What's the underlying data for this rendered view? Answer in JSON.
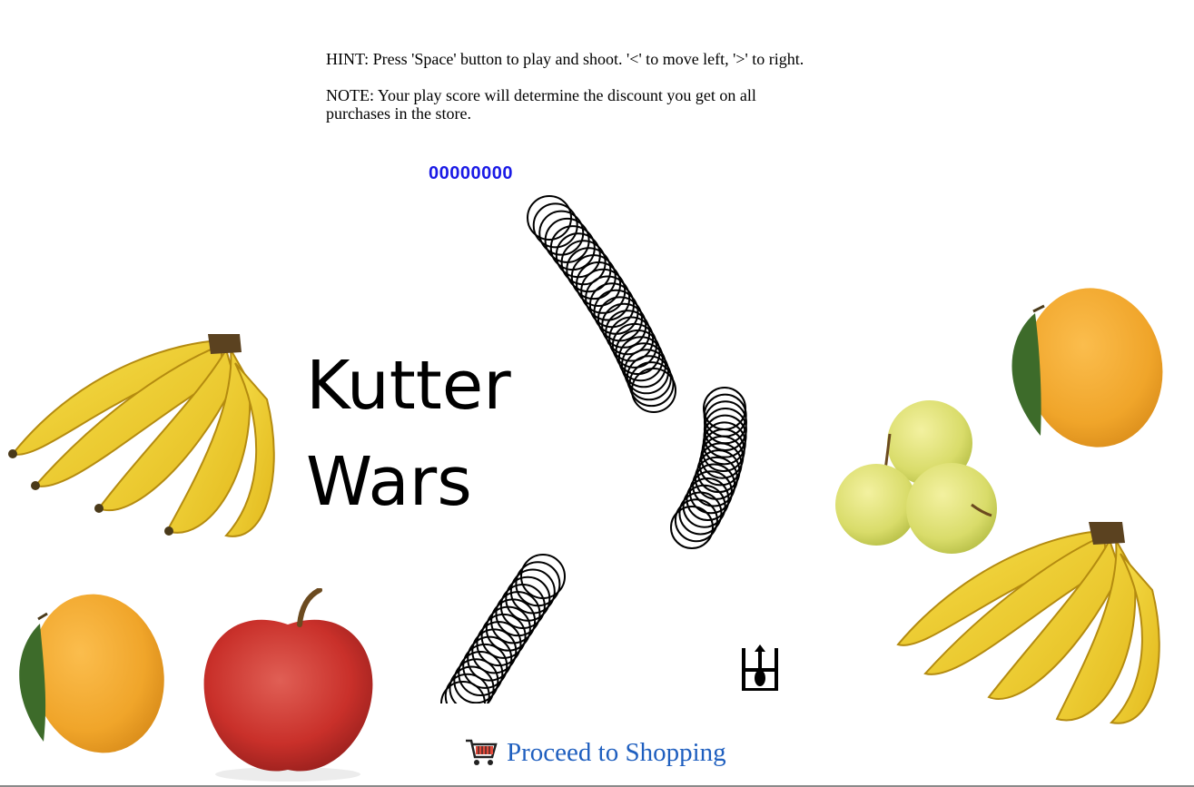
{
  "instructions": {
    "hint": "HINT: Press 'Space' button to play and shoot. '<' to move left, '>' to right.",
    "note": "NOTE: Your play score will determine the discount you get on all purchases in the store."
  },
  "game": {
    "score": "00000000",
    "title_line1": "Kutter",
    "title_line2": "Wars",
    "player_icon": "ship-icon",
    "enemies": "ring-chain-icons"
  },
  "decorations": {
    "left": [
      "banana-bunch",
      "mango",
      "red-apple"
    ],
    "right": [
      "mango",
      "green-apples",
      "banana-bunch"
    ]
  },
  "footer": {
    "cta_icon": "shopping-cart-icon",
    "cta_label": "Proceed to Shopping"
  },
  "colors": {
    "score": "#1a1ae6",
    "link": "#1f5fbf"
  }
}
